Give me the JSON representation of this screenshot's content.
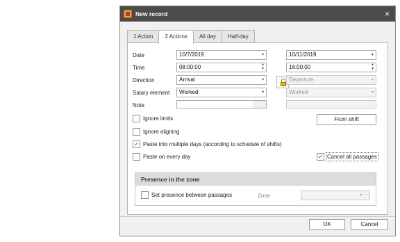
{
  "window": {
    "title": "New record",
    "close_glyph": "×",
    "icon": "app-record-icon"
  },
  "tabs": [
    {
      "label": "1 Action",
      "active": false
    },
    {
      "label": "2 Actions",
      "active": true
    },
    {
      "label": "All day",
      "active": false
    },
    {
      "label": "Half-day",
      "active": false
    }
  ],
  "form": {
    "date_label": "Date",
    "date1": "10/7/2019",
    "date2": "10/11/2019",
    "time_label": "Time",
    "time1": "08:00:00",
    "time2": "16:00:00",
    "direction_label": "Direction",
    "direction1": "Arrival",
    "direction2": "Departure",
    "salary_label": "Salary element",
    "salary1": "Worked",
    "salary2": "Worked",
    "note_label": "Note",
    "note1": "",
    "note2": "",
    "dropdown_glyph": "▾",
    "spin_glyph_up": "▴",
    "spin_glyph_down": "▾"
  },
  "options": {
    "ignore_limits": {
      "label": "Ignore limits",
      "checked": false
    },
    "ignore_aligning": {
      "label": "Ignore aligning",
      "checked": false
    },
    "paste_multiple": {
      "label": "Paste into multiple days (according to schedule of shifts)",
      "checked": true
    },
    "paste_every_day": {
      "label": "Paste on every day",
      "checked": false
    },
    "cancel_all_passages": {
      "label": "Cancel all passages",
      "checked": true
    },
    "check_glyph": "✓"
  },
  "buttons": {
    "from_shift": "From shift",
    "ok": "OK",
    "cancel": "Cancel"
  },
  "presence": {
    "header": "Presence in the zone",
    "set_presence": {
      "label": "Set presence between passages",
      "checked": false
    },
    "zone_label": "Zone",
    "zone_value": "",
    "zone_glyphs": "▾ ⋯"
  },
  "colors": {
    "titlebar": "#4b4b4b",
    "lock": "#e6b600",
    "group_header": "#dcdcdc"
  }
}
